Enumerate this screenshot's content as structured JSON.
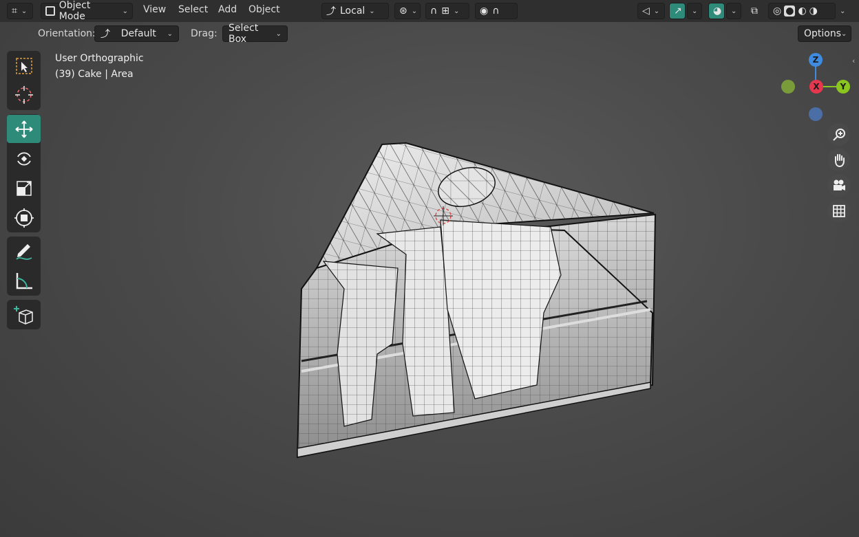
{
  "header": {
    "editor_icon": "grid-editor-icon",
    "mode_label": "Object Mode",
    "menus": [
      "View",
      "Select",
      "Add",
      "Object"
    ],
    "transform_orientation": "Local",
    "shading_active_color": "#2e8b7a"
  },
  "tool_settings": {
    "orientation_label": "Orientation:",
    "orientation_value": "Default",
    "drag_label": "Drag:",
    "drag_value": "Select Box",
    "options_label": "Options"
  },
  "viewport": {
    "view_name": "User Orthographic",
    "object_info": "(39) Cake | Area",
    "object": "cake-slice-wireframe-mesh"
  },
  "tools": [
    {
      "name": "select-box-tool",
      "active": false
    },
    {
      "name": "cursor-tool",
      "active": false
    },
    {
      "name": "move-tool",
      "active": true
    },
    {
      "name": "rotate-tool",
      "active": false
    },
    {
      "name": "scale-tool",
      "active": false
    },
    {
      "name": "transform-tool",
      "active": false
    },
    {
      "name": "annotate-tool",
      "active": false
    },
    {
      "name": "measure-tool",
      "active": false
    },
    {
      "name": "add-cube-tool",
      "active": false
    }
  ],
  "gizmo": {
    "z": "Z",
    "x": "X",
    "y": "Y",
    "colors": {
      "x": "#e5384e",
      "y": "#8bc51f",
      "z": "#3f8be0",
      "neg_x": "#7a9b3a",
      "neg_z": "#4b6ea6"
    }
  },
  "nav_buttons": [
    "zoom-icon",
    "hand-pan-icon",
    "camera-icon",
    "grid-ortho-icon"
  ]
}
